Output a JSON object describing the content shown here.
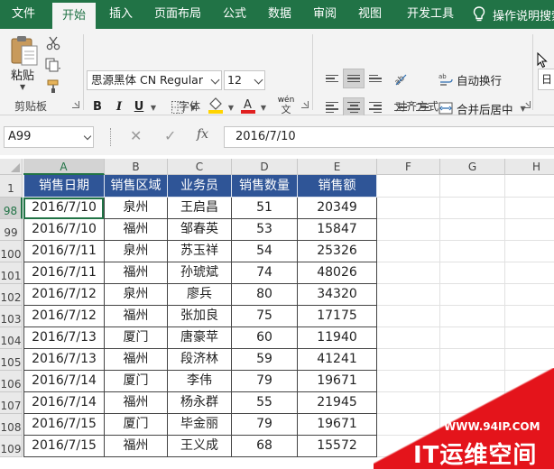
{
  "colors": {
    "excel_green": "#217346",
    "header_fill": "#2f5597",
    "watermark_red": "#e4141b"
  },
  "tabs": [
    {
      "label": "文件"
    },
    {
      "label": "开始",
      "active": true
    },
    {
      "label": "插入"
    },
    {
      "label": "页面布局"
    },
    {
      "label": "公式"
    },
    {
      "label": "数据"
    },
    {
      "label": "审阅"
    },
    {
      "label": "视图"
    },
    {
      "label": "开发工具"
    }
  ],
  "tell_me": {
    "label": "操作说明搜索",
    "icon": "lightbulb-icon"
  },
  "ribbon": {
    "clipboard": {
      "paste_label": "粘贴",
      "group_label": "剪贴板",
      "icons": [
        "cut-icon",
        "copy-icon",
        "format-painter-icon"
      ]
    },
    "font": {
      "font_name": "思源黑体 CN Regular",
      "font_size": "12",
      "bold": "B",
      "italic": "I",
      "underline": "U",
      "group_label": "字体",
      "icons": [
        "border-icon",
        "fill-color-icon",
        "font-color-icon",
        "phonetic-icon"
      ],
      "phonetic_glyph": "wén",
      "font_color": "#e02020",
      "fill_color": "#ffd400"
    },
    "alignment": {
      "wrap_text": "自动换行",
      "merge_center": "合并后居中",
      "group_label": "对齐方式"
    },
    "number": {
      "format": "日"
    }
  },
  "formula_bar": {
    "name_box": "A99",
    "cancel": "✕",
    "enter": "✓",
    "fx": "fx",
    "value": "2016/7/10"
  },
  "sheet": {
    "columns": [
      "A",
      "B",
      "C",
      "D",
      "E",
      "F",
      "G",
      "H"
    ],
    "header_row_number": "1",
    "headers": [
      "销售日期",
      "销售区域",
      "业务员",
      "销售数量",
      "销售额"
    ],
    "rows": [
      {
        "row": "98",
        "cells": [
          "2016/7/10",
          "泉州",
          "王启昌",
          "51",
          "20349"
        ]
      },
      {
        "row": "99",
        "cells": [
          "2016/7/10",
          "福州",
          "邹春英",
          "53",
          "15847"
        ]
      },
      {
        "row": "100",
        "cells": [
          "2016/7/11",
          "泉州",
          "苏玉祥",
          "54",
          "25326"
        ]
      },
      {
        "row": "101",
        "cells": [
          "2016/7/11",
          "福州",
          "孙琥斌",
          "74",
          "48026"
        ]
      },
      {
        "row": "102",
        "cells": [
          "2016/7/12",
          "泉州",
          "廖兵",
          "80",
          "34320"
        ]
      },
      {
        "row": "103",
        "cells": [
          "2016/7/12",
          "福州",
          "张加良",
          "75",
          "17175"
        ]
      },
      {
        "row": "104",
        "cells": [
          "2016/7/13",
          "厦门",
          "唐豪苹",
          "60",
          "11940"
        ]
      },
      {
        "row": "105",
        "cells": [
          "2016/7/13",
          "福州",
          "段济林",
          "59",
          "41241"
        ]
      },
      {
        "row": "106",
        "cells": [
          "2016/7/14",
          "厦门",
          "李伟",
          "79",
          "19671"
        ]
      },
      {
        "row": "107",
        "cells": [
          "2016/7/14",
          "福州",
          "杨永群",
          "55",
          "21945"
        ]
      },
      {
        "row": "108",
        "cells": [
          "2016/7/15",
          "厦门",
          "毕金丽",
          "79",
          "19671"
        ]
      },
      {
        "row": "109",
        "cells": [
          "2016/7/15",
          "福州",
          "王义成",
          "68",
          "15572"
        ]
      }
    ]
  },
  "watermark": {
    "url": "WWW.94IP.COM",
    "brand": "IT运维空间"
  }
}
